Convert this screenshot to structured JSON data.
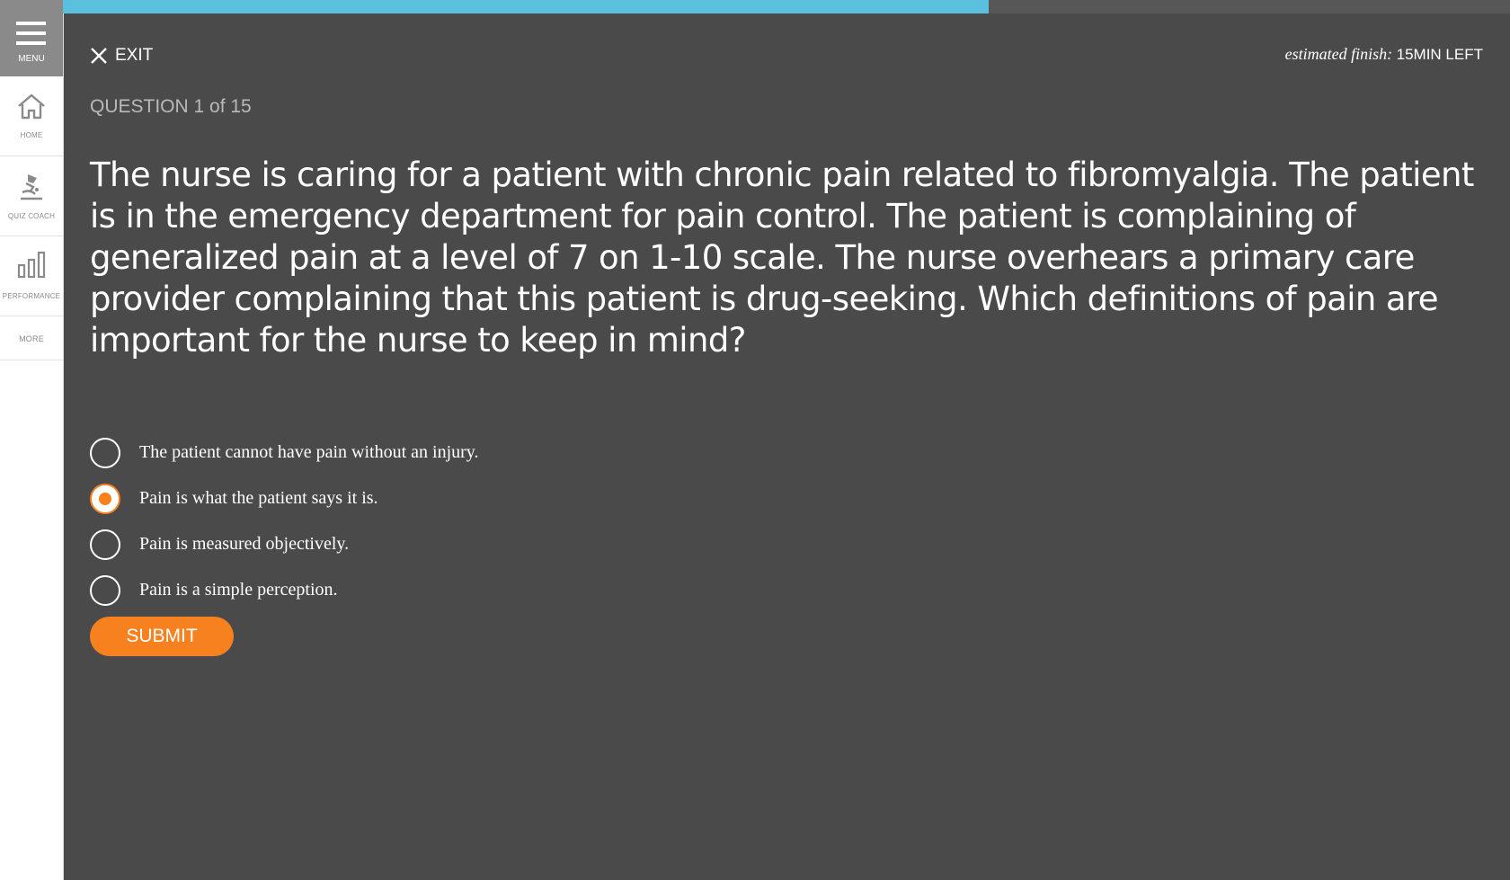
{
  "sidebar": {
    "menu_label": "MENU",
    "items": [
      {
        "label": "HOME",
        "icon": "home-icon"
      },
      {
        "label": "QUIZ COACH",
        "icon": "quiz-coach-icon"
      },
      {
        "label": "PERFORMANCE",
        "icon": "performance-chart-icon"
      },
      {
        "label": "MORE"
      }
    ]
  },
  "progress": {
    "fraction": 0.64,
    "color": "#5bc0de"
  },
  "header": {
    "exit_label": "EXIT",
    "estimate_label": "estimated finish:",
    "estimate_value": "15MIN LEFT"
  },
  "question": {
    "counter": "QUESTION 1 of 15",
    "text": "The nurse is caring for a patient with chronic pain related to fibromyalgia. The patient is in the emergency department for pain control. The patient is complaining of generalized pain at a level of 7 on 1-10 scale. The nurse overhears a primary care provider complaining that this patient is drug-seeking. Which definitions of pain are important for the nurse to keep in mind?"
  },
  "options": [
    {
      "text": "The patient cannot have pain without an injury.",
      "selected": false
    },
    {
      "text": "Pain is what the patient says it is.",
      "selected": true
    },
    {
      "text": "Pain is measured objectively.",
      "selected": false
    },
    {
      "text": "Pain is a simple perception.",
      "selected": false
    }
  ],
  "submit_label": "SUBMIT",
  "colors": {
    "accent": "#f7811f",
    "background": "#4a4a4a",
    "progress": "#5bc0de"
  }
}
